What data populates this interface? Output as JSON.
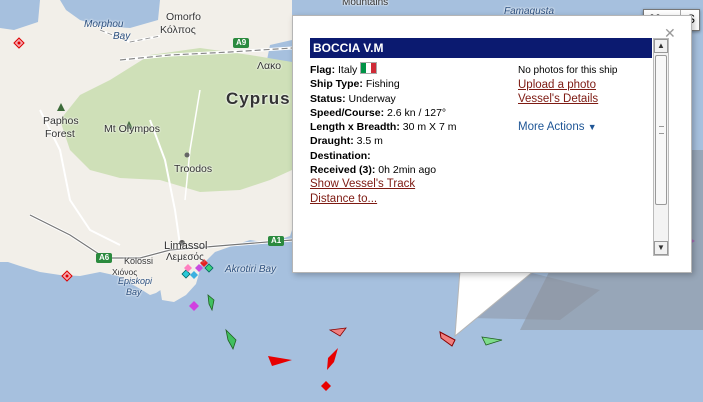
{
  "map": {
    "places": {
      "cyprus": "Cyprus",
      "morphou": "Morphou",
      "morphou_bay": "Bay",
      "omorfo": "Omorfo",
      "kato": "Κόλπος",
      "pergamos": "Λακο",
      "paphos": "Paphos",
      "paphos_forest": "Forest",
      "mt_olympos": "Mt Olympos",
      "troodos": "Troodos",
      "limassol": "Limassol",
      "lemesos": "Λεμεσός",
      "kolossi": "Kolossi",
      "akrotiri_bay": "Akrotiri Bay",
      "episkopi_bay": "Episkopi",
      "episkopi_bay2": "Bay",
      "xiokopi": "Χιόνος",
      "mountains": "Mountains",
      "famagusta": "Famagusta"
    },
    "roads": {
      "a9": "A9",
      "a6": "A6",
      "a1": "A1"
    },
    "map_type": {
      "active": "Map",
      "inactive": "S"
    },
    "colors": {
      "sea": "#a6c0de",
      "land": "#f2efe9",
      "forest": "#cfe0b8",
      "road_shield": "#2b8a3e"
    }
  },
  "popup": {
    "title": "BOCCIA V.M",
    "close_icon": "close-icon",
    "flag": {
      "label": "Flag:",
      "value": "Italy"
    },
    "ship_type": {
      "label": "Ship Type:",
      "value": "Fishing"
    },
    "status": {
      "label": "Status:",
      "value": "Underway"
    },
    "speed": {
      "label": "Speed/Course:",
      "value": "2.6 kn / 127°"
    },
    "dims": {
      "label": "Length x Breadth:",
      "value": "30 m X 7 m"
    },
    "draught": {
      "label": "Draught:",
      "value": "3.5 m"
    },
    "destination": {
      "label": "Destination:",
      "value": ""
    },
    "received": {
      "label": "Received (3):",
      "value": "0h 2min ago"
    },
    "show_track": "Show Vessel's Track",
    "distance": "Distance to...",
    "no_photos": "No photos for this ship",
    "upload_photo": "Upload a photo",
    "details": "Vessel's Details",
    "more_actions": "More Actions"
  }
}
